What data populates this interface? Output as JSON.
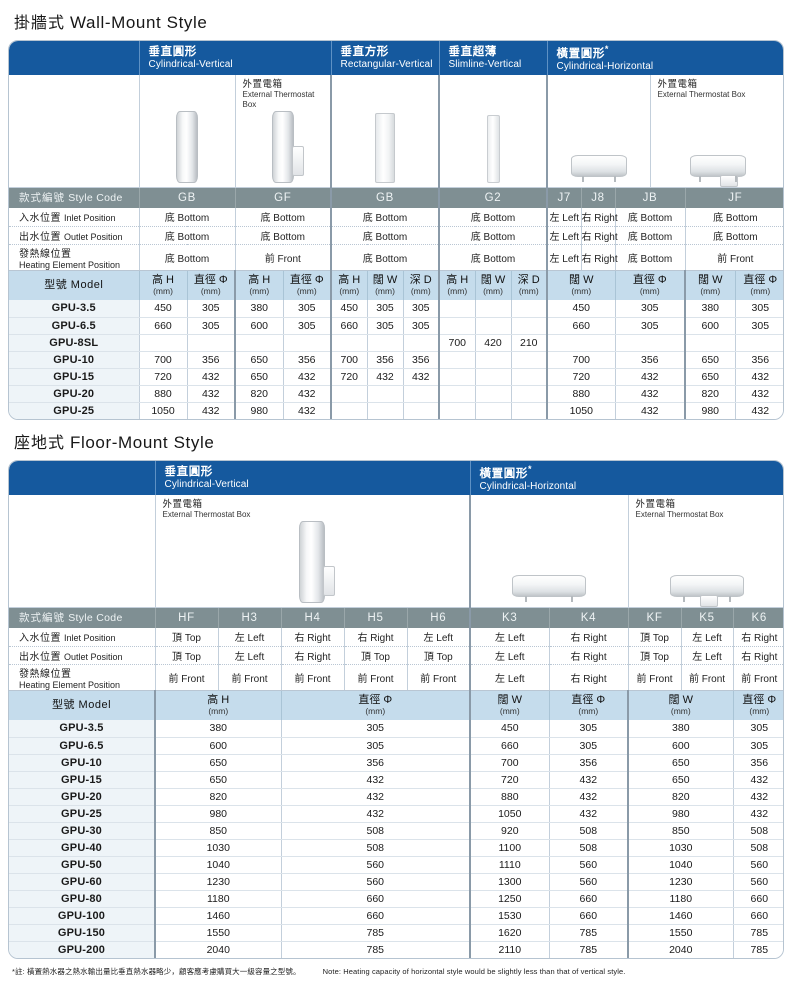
{
  "wall": {
    "title_cn": "掛牆式",
    "title_en": "Wall-Mount Style",
    "groups": [
      {
        "cn": "垂直圓形",
        "en": "Cylindrical-Vertical",
        "star": false
      },
      {
        "cn": "垂直方形",
        "en": "Rectangular-Vertical",
        "star": false
      },
      {
        "cn": "垂直超薄",
        "en": "Slimline-Vertical",
        "star": false
      },
      {
        "cn": "橫置圓形",
        "en": "Cylindrical-Horizontal",
        "star": true
      }
    ],
    "thermostat_label": {
      "cn": "外置電箱",
      "en": "External Thermostat Box"
    },
    "style_code_label": {
      "cn": "款式編號",
      "en": "Style Code"
    },
    "style_codes": [
      "GB",
      "GF",
      "GB",
      "G2",
      "J7",
      "J8",
      "JB",
      "JF"
    ],
    "rows": [
      {
        "label_cn": "入水位置",
        "label_en": "Inlet Position",
        "values": [
          "底 Bottom",
          "底 Bottom",
          "底 Bottom",
          "底 Bottom",
          "左 Left",
          "右 Right",
          "底 Bottom",
          "底 Bottom"
        ]
      },
      {
        "label_cn": "出水位置",
        "label_en": "Outlet Position",
        "values": [
          "底 Bottom",
          "底 Bottom",
          "底 Bottom",
          "底 Bottom",
          "左 Left",
          "右 Right",
          "底 Bottom",
          "底 Bottom"
        ]
      },
      {
        "label_cn": "發熱線位置",
        "label_en": "Heating Element Position",
        "values": [
          "底 Bottom",
          "前 Front",
          "底 Bottom",
          "底 Bottom",
          "左 Left",
          "右 Right",
          "底 Bottom",
          "前 Front"
        ]
      }
    ],
    "model_label": {
      "cn": "型號",
      "en": "Model"
    },
    "unit": "(mm)",
    "dim_headers": [
      "高 H",
      "直徑 Φ",
      "高 H",
      "直徑 Φ",
      "高 H",
      "闊 W",
      "深 D",
      "高 H",
      "闊 W",
      "深 D",
      "闊 W",
      "直徑 Φ",
      "闊 W",
      "直徑 Φ"
    ],
    "models": [
      {
        "name": "GPU-3.5",
        "dims": [
          "450",
          "305",
          "380",
          "305",
          "450",
          "305",
          "305",
          "",
          "",
          "",
          "450",
          "305",
          "380",
          "305"
        ]
      },
      {
        "name": "GPU-6.5",
        "dims": [
          "660",
          "305",
          "600",
          "305",
          "660",
          "305",
          "305",
          "",
          "",
          "",
          "660",
          "305",
          "600",
          "305"
        ]
      },
      {
        "name": "GPU-8SL",
        "dims": [
          "",
          "",
          "",
          "",
          "",
          "",
          "",
          "700",
          "420",
          "210",
          "",
          "",
          "",
          ""
        ]
      },
      {
        "name": "GPU-10",
        "dims": [
          "700",
          "356",
          "650",
          "356",
          "700",
          "356",
          "356",
          "",
          "",
          "",
          "700",
          "356",
          "650",
          "356"
        ]
      },
      {
        "name": "GPU-15",
        "dims": [
          "720",
          "432",
          "650",
          "432",
          "720",
          "432",
          "432",
          "",
          "",
          "",
          "720",
          "432",
          "650",
          "432"
        ]
      },
      {
        "name": "GPU-20",
        "dims": [
          "880",
          "432",
          "820",
          "432",
          "",
          "",
          "",
          "",
          "",
          "",
          "880",
          "432",
          "820",
          "432"
        ]
      },
      {
        "name": "GPU-25",
        "dims": [
          "1050",
          "432",
          "980",
          "432",
          "",
          "",
          "",
          "",
          "",
          "",
          "1050",
          "432",
          "980",
          "432"
        ]
      }
    ]
  },
  "floor": {
    "title_cn": "座地式",
    "title_en": "Floor-Mount Style",
    "groups": [
      {
        "cn": "垂直圓形",
        "en": "Cylindrical-Vertical",
        "star": false
      },
      {
        "cn": "橫置圓形",
        "en": "Cylindrical-Horizontal",
        "star": true
      }
    ],
    "thermostat_label": {
      "cn": "外置電箱",
      "en": "External Thermostat Box"
    },
    "style_code_label": {
      "cn": "款式編號",
      "en": "Style Code"
    },
    "style_codes": [
      "HF",
      "H3",
      "H4",
      "H5",
      "H6",
      "K3",
      "K4",
      "KF",
      "K5",
      "K6"
    ],
    "rows": [
      {
        "label_cn": "入水位置",
        "label_en": "Inlet Position",
        "values": [
          "頂 Top",
          "左 Left",
          "右 Right",
          "右 Right",
          "左 Left",
          "左 Left",
          "右 Right",
          "頂 Top",
          "左 Left",
          "右 Right"
        ]
      },
      {
        "label_cn": "出水位置",
        "label_en": "Outlet Position",
        "values": [
          "頂 Top",
          "左 Left",
          "右 Right",
          "頂 Top",
          "頂 Top",
          "左 Left",
          "右 Right",
          "頂 Top",
          "左 Left",
          "右 Right"
        ]
      },
      {
        "label_cn": "發熱線位置",
        "label_en": "Heating Element Position",
        "values": [
          "前 Front",
          "前 Front",
          "前 Front",
          "前 Front",
          "前 Front",
          "左 Left",
          "右 Right",
          "前 Front",
          "前 Front",
          "前 Front"
        ]
      }
    ],
    "model_label": {
      "cn": "型號",
      "en": "Model"
    },
    "unit": "(mm)",
    "dim_headers": [
      "高 H",
      "直徑 Φ",
      "闊 W",
      "直徑 Φ",
      "闊 W",
      "直徑 Φ"
    ],
    "models": [
      {
        "name": "GPU-3.5",
        "dims": [
          "380",
          "305",
          "450",
          "305",
          "380",
          "305"
        ]
      },
      {
        "name": "GPU-6.5",
        "dims": [
          "600",
          "305",
          "660",
          "305",
          "600",
          "305"
        ]
      },
      {
        "name": "GPU-10",
        "dims": [
          "650",
          "356",
          "700",
          "356",
          "650",
          "356"
        ]
      },
      {
        "name": "GPU-15",
        "dims": [
          "650",
          "432",
          "720",
          "432",
          "650",
          "432"
        ]
      },
      {
        "name": "GPU-20",
        "dims": [
          "820",
          "432",
          "880",
          "432",
          "820",
          "432"
        ]
      },
      {
        "name": "GPU-25",
        "dims": [
          "980",
          "432",
          "1050",
          "432",
          "980",
          "432"
        ]
      },
      {
        "name": "GPU-30",
        "dims": [
          "850",
          "508",
          "920",
          "508",
          "850",
          "508"
        ]
      },
      {
        "name": "GPU-40",
        "dims": [
          "1030",
          "508",
          "1100",
          "508",
          "1030",
          "508"
        ]
      },
      {
        "name": "GPU-50",
        "dims": [
          "1040",
          "560",
          "1110",
          "560",
          "1040",
          "560"
        ]
      },
      {
        "name": "GPU-60",
        "dims": [
          "1230",
          "560",
          "1300",
          "560",
          "1230",
          "560"
        ]
      },
      {
        "name": "GPU-80",
        "dims": [
          "1180",
          "660",
          "1250",
          "660",
          "1180",
          "660"
        ]
      },
      {
        "name": "GPU-100",
        "dims": [
          "1460",
          "660",
          "1530",
          "660",
          "1460",
          "660"
        ]
      },
      {
        "name": "GPU-150",
        "dims": [
          "1550",
          "785",
          "1620",
          "785",
          "1550",
          "785"
        ]
      },
      {
        "name": "GPU-200",
        "dims": [
          "2040",
          "785",
          "2110",
          "785",
          "2040",
          "785"
        ]
      }
    ]
  },
  "footnote": {
    "cn": "*註: 橫置熱水器之熱水輸出量比垂直熱水器略少，顧客應考慮購買大一級容量之型號。",
    "en": "Note: Heating capacity of horizontal style would be slightly less than that of vertical style."
  },
  "colors": {
    "banner_blue": "#15599e",
    "code_gray": "#7f8f93",
    "model_blue": "#c5dcec",
    "row_alt": "#eef4f8"
  }
}
